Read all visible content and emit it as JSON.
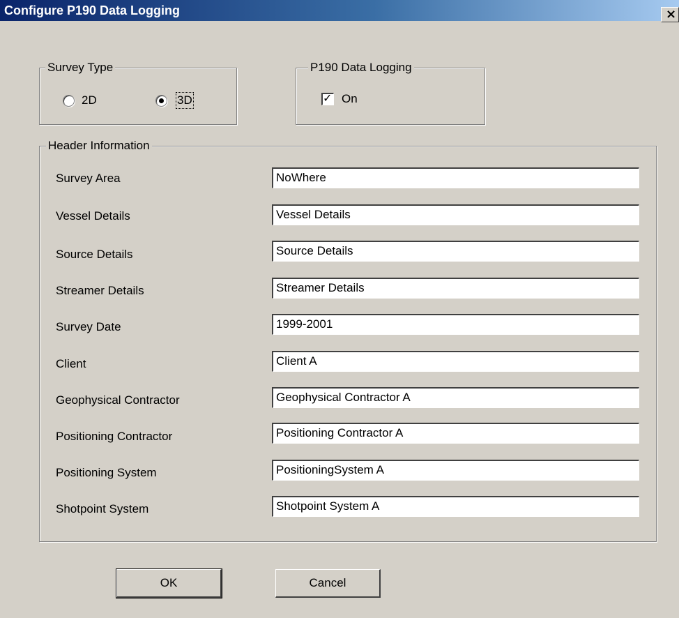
{
  "window": {
    "title": "Configure P190 Data Logging",
    "close_glyph": "×"
  },
  "survey_type": {
    "legend": "Survey Type",
    "options": [
      {
        "label": "2D",
        "selected": false
      },
      {
        "label": "3D",
        "selected": true
      }
    ]
  },
  "logging": {
    "legend": "P190 Data Logging",
    "checkbox_label": "On",
    "checked": true
  },
  "header_info": {
    "legend": "Header Information",
    "fields": [
      {
        "label": "Survey Area",
        "value": "NoWhere"
      },
      {
        "label": "Vessel Details",
        "value": "Vessel Details"
      },
      {
        "label": "Source Details",
        "value": "Source Details"
      },
      {
        "label": "Streamer Details",
        "value": "Streamer Details"
      },
      {
        "label": "Survey Date",
        "value": "1999-2001"
      },
      {
        "label": "Client",
        "value": "Client A"
      },
      {
        "label": "Geophysical Contractor",
        "value": "Geophysical Contractor A"
      },
      {
        "label": "Positioning Contractor",
        "value": "Positioning Contractor A"
      },
      {
        "label": "Positioning System",
        "value": "PositioningSystem A"
      },
      {
        "label": "Shotpoint System",
        "value": "Shotpoint System A"
      }
    ]
  },
  "buttons": {
    "ok": "OK",
    "cancel": "Cancel"
  },
  "icons": {
    "close": "close-icon",
    "checkmark": "checkmark-icon",
    "radio_dot": "radio-dot-icon"
  },
  "colors": {
    "dialog_bg": "#d4d0c8",
    "titlebar_start": "#0a246a",
    "titlebar_end": "#a6caf0",
    "title_text": "#ffffff"
  }
}
